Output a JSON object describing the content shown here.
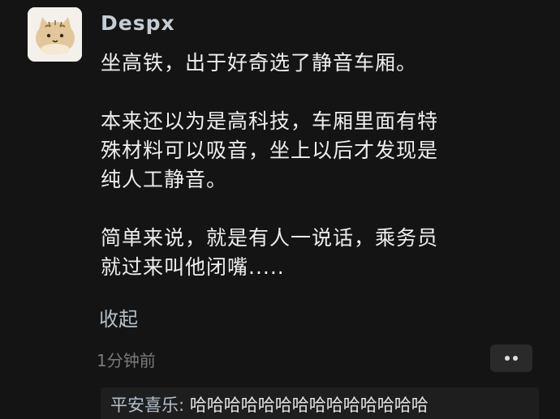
{
  "post": {
    "username": "Despx",
    "avatar_icon": "cat-avatar-icon",
    "paragraphs": [
      "坐高铁，出于好奇选了静音车厢。",
      "本来还以为是高科技，车厢里面有特殊材料可以吸音，坐上以后才发现是纯人工静音。",
      "简单来说，就是有人一说话，乘务员就过来叫他闭嘴....."
    ],
    "collapse_label": "收起",
    "timestamp": "1分钟前",
    "more_icon": "more-dots-icon"
  },
  "reply": {
    "author": "平安喜乐: ",
    "text": "哈哈哈哈哈哈哈哈哈哈哈哈哈哈"
  },
  "colors": {
    "background": "#141414",
    "username": "#c5cdd4",
    "link": "#b4bfca",
    "timestamp": "#7a7a7a"
  }
}
